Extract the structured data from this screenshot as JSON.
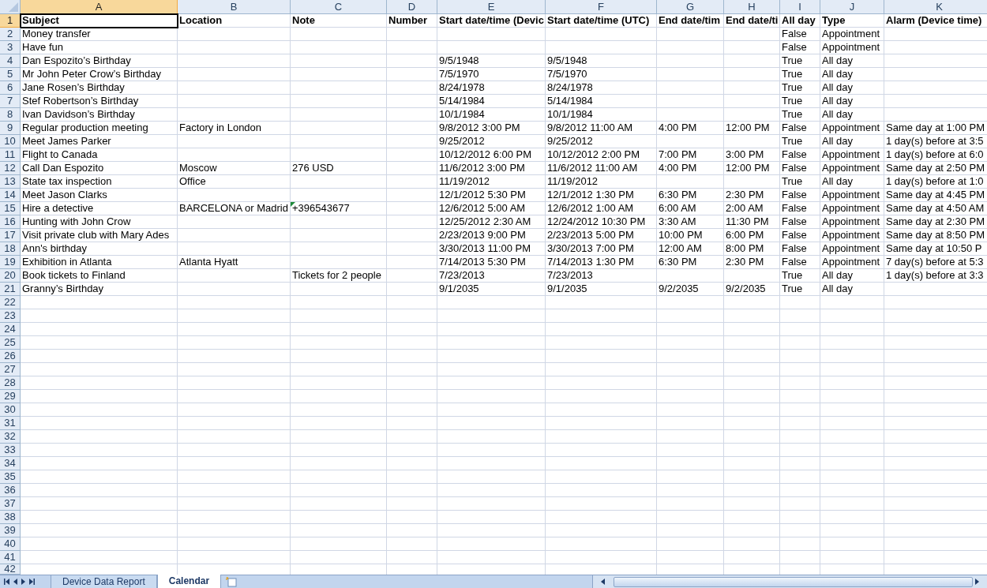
{
  "columns": [
    {
      "label": "A",
      "selected": true
    },
    {
      "label": "B",
      "selected": false
    },
    {
      "label": "C",
      "selected": false
    },
    {
      "label": "D",
      "selected": false
    },
    {
      "label": "E",
      "selected": false
    },
    {
      "label": "F",
      "selected": false
    },
    {
      "label": "G",
      "selected": false
    },
    {
      "label": "H",
      "selected": false
    },
    {
      "label": "I",
      "selected": false
    },
    {
      "label": "J",
      "selected": false
    },
    {
      "label": "K",
      "selected": false
    }
  ],
  "rows": [
    {
      "number": "1",
      "selected": true,
      "header": true,
      "cells": [
        "Subject",
        "Location",
        "Note",
        "Number",
        "Start date/time (Devic",
        "Start date/time (UTC)",
        "End date/tim",
        "End date/ti",
        "All day",
        "Type",
        "Alarm (Device time)"
      ]
    },
    {
      "number": "2",
      "selected": false,
      "cells": [
        "Money transfer",
        "",
        "",
        "",
        "",
        "",
        "",
        "",
        "False",
        "Appointment",
        ""
      ]
    },
    {
      "number": "3",
      "selected": false,
      "cells": [
        "Have fun",
        "",
        "",
        "",
        "",
        "",
        "",
        "",
        "False",
        "Appointment",
        ""
      ]
    },
    {
      "number": "4",
      "selected": false,
      "cells": [
        "Dan Espozito’s Birthday",
        "",
        "",
        "",
        "9/5/1948",
        "9/5/1948",
        "",
        "",
        "True",
        "All day",
        ""
      ]
    },
    {
      "number": "5",
      "selected": false,
      "cells": [
        "Mr John Peter Crow’s Birthday",
        "",
        "",
        "",
        "7/5/1970",
        "7/5/1970",
        "",
        "",
        "True",
        "All day",
        ""
      ]
    },
    {
      "number": "6",
      "selected": false,
      "cells": [
        "Jane Rosen’s Birthday",
        "",
        "",
        "",
        "8/24/1978",
        "8/24/1978",
        "",
        "",
        "True",
        "All day",
        ""
      ]
    },
    {
      "number": "7",
      "selected": false,
      "cells": [
        "Stef Robertson’s Birthday",
        "",
        "",
        "",
        "5/14/1984",
        "5/14/1984",
        "",
        "",
        "True",
        "All day",
        ""
      ]
    },
    {
      "number": "8",
      "selected": false,
      "cells": [
        "Ivan Davidson’s Birthday",
        "",
        "",
        "",
        "10/1/1984",
        "10/1/1984",
        "",
        "",
        "True",
        "All day",
        ""
      ]
    },
    {
      "number": "9",
      "selected": false,
      "cells": [
        "Regular production meeting",
        "Factory in London",
        "",
        "",
        "9/8/2012 3:00 PM",
        "9/8/2012 11:00 AM",
        "4:00 PM",
        "12:00 PM",
        "False",
        "Appointment",
        "Same day at 1:00 PM"
      ]
    },
    {
      "number": "10",
      "selected": false,
      "cells": [
        "Meet James Parker",
        "",
        "",
        "",
        "9/25/2012",
        "9/25/2012",
        "",
        "",
        "True",
        "All day",
        "1 day(s) before at 3:5"
      ]
    },
    {
      "number": "11",
      "selected": false,
      "cells": [
        "Flight to Canada",
        "",
        "",
        "",
        "10/12/2012 6:00 PM",
        "10/12/2012 2:00 PM",
        "7:00 PM",
        "3:00 PM",
        "False",
        "Appointment",
        "1 day(s) before at 6:0"
      ]
    },
    {
      "number": "12",
      "selected": false,
      "cells": [
        "Call Dan Espozito",
        "Moscow",
        "276 USD",
        "",
        "11/6/2012 3:00 PM",
        "11/6/2012 11:00 AM",
        "4:00 PM",
        "12:00 PM",
        "False",
        "Appointment",
        "Same day at 2:50 PM"
      ]
    },
    {
      "number": "13",
      "selected": false,
      "cells": [
        "State tax inspection",
        "Office",
        "",
        "",
        "11/19/2012",
        "11/19/2012",
        "",
        "",
        "True",
        "All day",
        "1 day(s) before at 1:0"
      ]
    },
    {
      "number": "14",
      "selected": false,
      "cells": [
        "Meet Jason Clarks",
        "",
        "",
        "",
        "12/1/2012 5:30 PM",
        "12/1/2012 1:30 PM",
        "6:30 PM",
        "2:30 PM",
        "False",
        "Appointment",
        "Same day at 4:45 PM"
      ]
    },
    {
      "number": "15",
      "selected": false,
      "cells": [
        "Hire a detective",
        "BARCELONA or Madrid",
        {
          "text": "+396543677",
          "error_flag": true
        },
        "",
        "12/6/2012 5:00 AM",
        "12/6/2012 1:00 AM",
        "6:00 AM",
        "2:00 AM",
        "False",
        "Appointment",
        "Same day at 4:50 AM"
      ]
    },
    {
      "number": "16",
      "selected": false,
      "cells": [
        "Hunting with John Crow",
        "",
        "",
        "",
        "12/25/2012 2:30 AM",
        "12/24/2012 10:30 PM",
        "3:30 AM",
        "11:30 PM",
        "False",
        "Appointment",
        "Same day at 2:30 PM"
      ]
    },
    {
      "number": "17",
      "selected": false,
      "cells": [
        "Visit private club with Mary Ades",
        "",
        "",
        "",
        "2/23/2013 9:00 PM",
        "2/23/2013 5:00 PM",
        "10:00 PM",
        "6:00 PM",
        "False",
        "Appointment",
        "Same day at 8:50 PM"
      ]
    },
    {
      "number": "18",
      "selected": false,
      "cells": [
        "Ann's birthday",
        "",
        "",
        "",
        "3/30/2013 11:00 PM",
        "3/30/2013 7:00 PM",
        "12:00 AM",
        "8:00 PM",
        "False",
        "Appointment",
        "Same day at 10:50 P"
      ]
    },
    {
      "number": "19",
      "selected": false,
      "cells": [
        "Exhibition in Atlanta",
        "Atlanta Hyatt",
        "",
        "",
        "7/14/2013 5:30 PM",
        "7/14/2013 1:30 PM",
        "6:30 PM",
        "2:30 PM",
        "False",
        "Appointment",
        "7 day(s) before at 5:3"
      ]
    },
    {
      "number": "20",
      "selected": false,
      "cells": [
        "Book tickets to Finland",
        "",
        "Tickets for 2 people",
        "",
        "7/23/2013",
        "7/23/2013",
        "",
        "",
        "True",
        "All day",
        "1 day(s) before at 3:3"
      ]
    },
    {
      "number": "21",
      "selected": false,
      "cells": [
        "Granny’s Birthday",
        "",
        "",
        "",
        "9/1/2035",
        "9/1/2035",
        "9/2/2035",
        "9/2/2035",
        "True",
        "All day",
        ""
      ]
    },
    {
      "number": "22",
      "selected": false
    },
    {
      "number": "23",
      "selected": false
    },
    {
      "number": "24",
      "selected": false
    },
    {
      "number": "25",
      "selected": false
    },
    {
      "number": "26",
      "selected": false
    },
    {
      "number": "27",
      "selected": false
    },
    {
      "number": "28",
      "selected": false
    },
    {
      "number": "29",
      "selected": false
    },
    {
      "number": "30",
      "selected": false
    },
    {
      "number": "31",
      "selected": false
    },
    {
      "number": "32",
      "selected": false
    },
    {
      "number": "33",
      "selected": false
    },
    {
      "number": "34",
      "selected": false
    },
    {
      "number": "35",
      "selected": false
    },
    {
      "number": "36",
      "selected": false
    },
    {
      "number": "37",
      "selected": false
    },
    {
      "number": "38",
      "selected": false
    },
    {
      "number": "39",
      "selected": false
    },
    {
      "number": "40",
      "selected": false
    },
    {
      "number": "41",
      "selected": false
    },
    {
      "number": "42",
      "selected": false
    }
  ],
  "sheet_tabs": [
    {
      "label": "Device Data Report",
      "selected": false
    },
    {
      "label": "Calendar",
      "selected": true
    }
  ]
}
